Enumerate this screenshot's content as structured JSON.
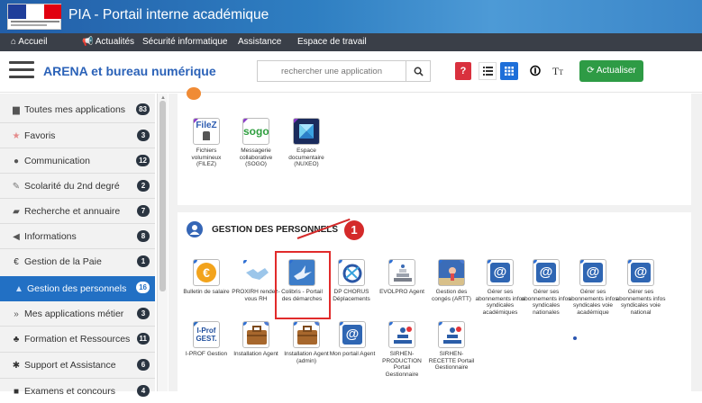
{
  "window": {
    "title": "PIA - Portail interne académique"
  },
  "nav": {
    "items": [
      "Accueil",
      "Actualités",
      "Sécurité informatique",
      "Assistance",
      "Espace de travail"
    ]
  },
  "header": {
    "title": "ARENA et bureau numérique",
    "search_placeholder": "rechercher une application",
    "btn_help": "?",
    "btn_tt": "T",
    "refresh_label": "Actualiser"
  },
  "sidebar": {
    "items": [
      {
        "label": "Toutes mes applications",
        "count": "83",
        "icon": "folder-icon"
      },
      {
        "label": "Favoris",
        "count": "3",
        "icon": "star-icon"
      },
      {
        "label": "Communication",
        "count": "12",
        "icon": "microphone-icon"
      },
      {
        "label": "Scolarité du 2nd degré",
        "count": "2",
        "icon": "edit-icon"
      },
      {
        "label": "Recherche et annuaire",
        "count": "7",
        "icon": "book-icon"
      },
      {
        "label": "Informations",
        "count": "8",
        "icon": "megaphone-icon"
      },
      {
        "label": "Gestion de la Paie",
        "count": "1",
        "icon": "euro-icon"
      },
      {
        "label": "Gestion des personnels",
        "count": "16",
        "icon": "person-icon",
        "active": true
      },
      {
        "label": "Mes applications métier",
        "count": "3",
        "icon": "chevron-icon"
      },
      {
        "label": "Formation et Ressources",
        "count": "11",
        "icon": "sitemap-icon"
      },
      {
        "label": "Support et Assistance",
        "count": "6",
        "icon": "gear-icon"
      },
      {
        "label": "Examens et concours",
        "count": "4",
        "icon": "briefcase-icon"
      }
    ]
  },
  "top_apps": [
    {
      "label": "Fichiers volumineux (FILEZ)",
      "icon": "filez-icon"
    },
    {
      "label": "Messagerie collaborative (SOGO)",
      "icon": "sogo-icon"
    },
    {
      "label": "Espace documentaire (NUXEO)",
      "icon": "nuxeo-icon"
    }
  ],
  "section": {
    "title": "GESTION DES PERSONNELS"
  },
  "row1": [
    {
      "label": "Bulletin de salaire",
      "icon": "euro-icon"
    },
    {
      "label": "PROXIRH rendez-vous RH",
      "icon": "handshake-icon"
    },
    {
      "label": "Colibris - Portail des démarches",
      "icon": "bird-icon"
    },
    {
      "label": "DP CHORUS Déplacements",
      "icon": "chorus-icon"
    },
    {
      "label": "EVOLPRO Agent",
      "icon": "steps-icon"
    },
    {
      "label": "Gestion des congés (ARTT)",
      "icon": "holiday-icon"
    },
    {
      "label": "Gérer ses abonnements infos syndicales académiques",
      "icon": "at-icon"
    },
    {
      "label": "Gérer ses abonnements infos syndicales nationales",
      "icon": "at-icon"
    },
    {
      "label": "Gérer ses abonnements infos syndicales voie académique",
      "icon": "at-icon"
    },
    {
      "label": "Gérer ses abonnements infos syndicales voie national",
      "icon": "at-icon"
    }
  ],
  "row2": [
    {
      "label": "I-PROF Gestion",
      "icon": "iprof-icon",
      "tile_text": "I-Prof GEST."
    },
    {
      "label": "Installation Agent",
      "icon": "briefcase-icon"
    },
    {
      "label": "Installation Agent (admin)",
      "icon": "briefcase-icon"
    },
    {
      "label": "Mon portail Agent",
      "icon": "at-icon"
    },
    {
      "label": "SIRHEN-PRODUCTION Portail Gestionnaire",
      "icon": "sirhen-icon"
    },
    {
      "label": "SIRHEN-RECETTE Portail Gestionnaire",
      "icon": "sirhen-icon"
    }
  ],
  "annotation": {
    "number": "1"
  }
}
